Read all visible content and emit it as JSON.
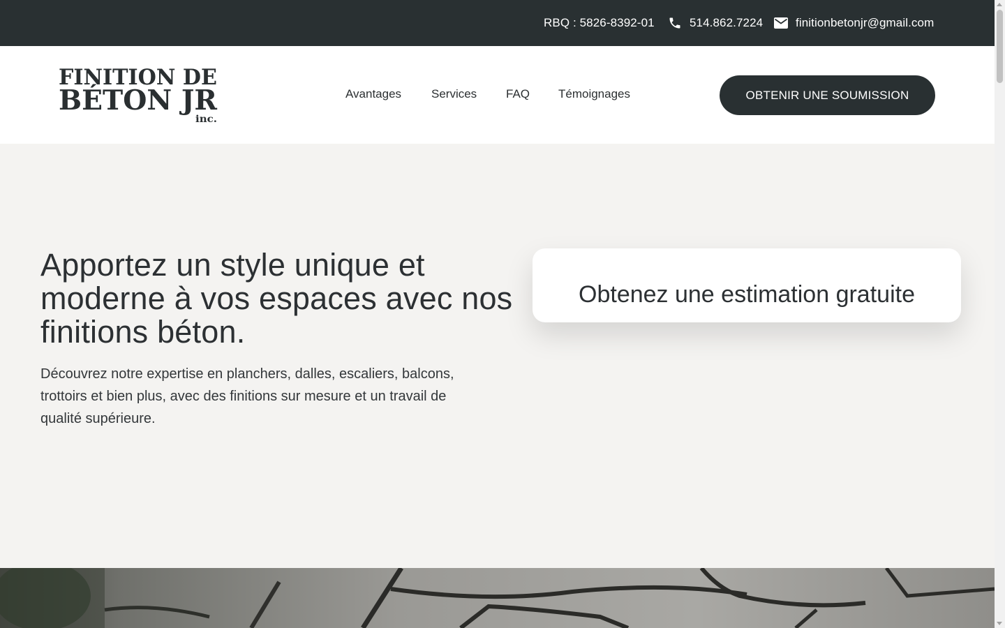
{
  "topbar": {
    "rbq": "RBQ : 5826-8392-01",
    "phone": "514.862.7224",
    "email": "finitionbetonjr@gmail.com",
    "phone_icon": "phone-icon",
    "email_icon": "envelope-icon"
  },
  "logo": {
    "line1": "FINITION DE",
    "line2": "BÉTON JR",
    "line3": "inc."
  },
  "nav": {
    "items": [
      {
        "label": "Avantages"
      },
      {
        "label": "Services"
      },
      {
        "label": "FAQ"
      },
      {
        "label": "Témoignages"
      }
    ],
    "cta_label": "OBTENIR UNE SOUMISSION"
  },
  "hero": {
    "headline": "Apportez un style unique et moderne  à vos espaces avec nos finitions béton.",
    "description": "Découvrez notre expertise en planchers, dalles, escaliers, balcons, trottoirs  et bien plus, avec des finitions sur mesure et un travail de qualité supérieure.",
    "estimate_card_title": "Obtenez une estimation gratuite"
  },
  "colors": {
    "dark": "#293032",
    "hero_bg": "#f4f3f1",
    "text": "#2c3033",
    "white": "#ffffff"
  }
}
